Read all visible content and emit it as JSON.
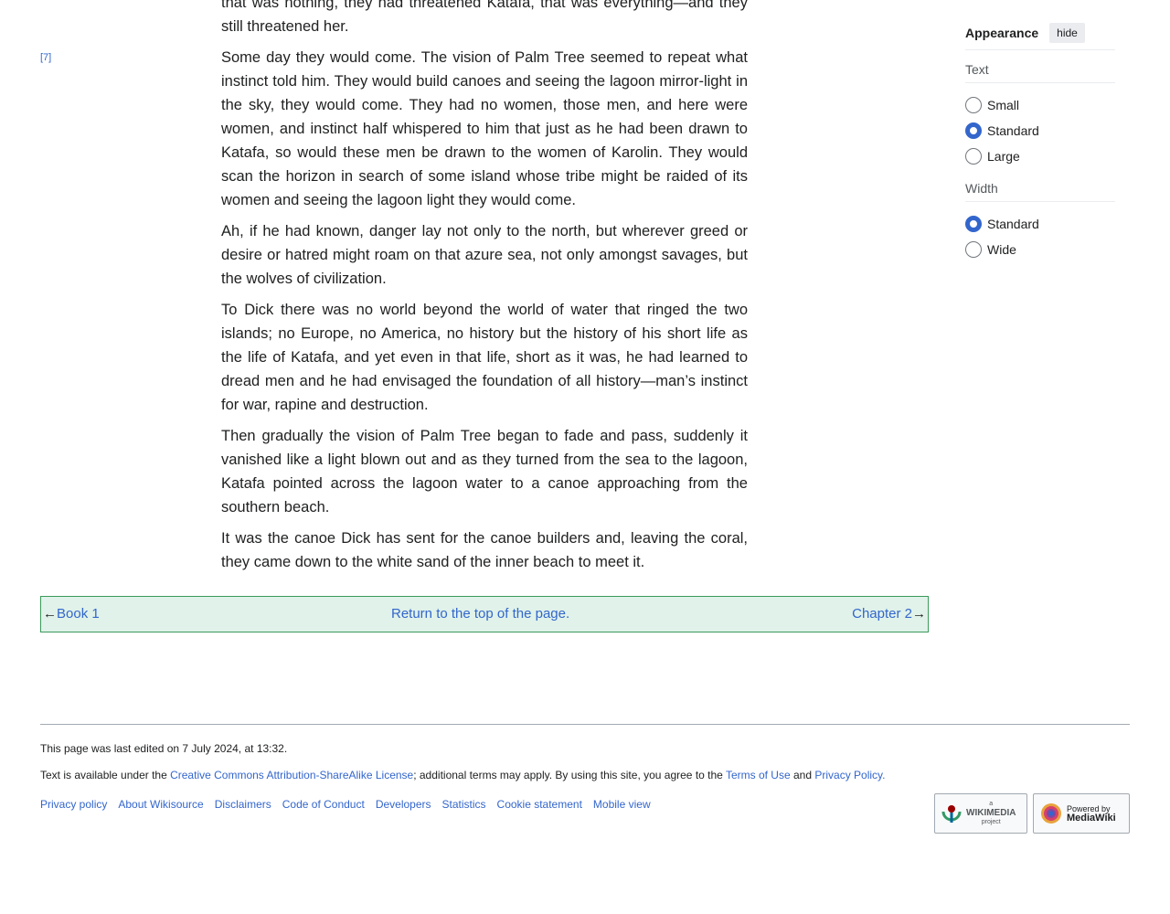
{
  "page_marker": "[7]",
  "paragraphs": [
    "that was nothing, they had threatened Katafa, that was everything—and they still threatened her.",
    "Some day they would come. The vision of Palm Tree seemed to repeat what instinct told him. They would build canoes and seeing the lagoon mirror-light in the sky, they would come. They had no women, those men, and here were women, and instinct half whispered to him that just as he had been drawn to Katafa, so would these men be drawn to the women of Karolin. They would scan the horizon in search of some island whose tribe might be raided of its women and seeing the lagoon light they would come.",
    "Ah, if he had known, danger lay not only to the north, but wherever greed or desire or hatred might roam on that azure sea, not only amongst savages, but the wolves of civilization.",
    "To Dick there was no world beyond the world of water that ringed the two islands; no Europe, no America, no history but the history of his short life as the life of Katafa, and yet even in that life, short as it was, he had learned to dread men and he had envisaged the foundation of all history—man’s instinct for war, rapine and destruction.",
    "Then gradually the vision of Palm Tree began to fade and pass, suddenly it vanished like a light blown out and as they turned from the sea to the lagoon, Katafa pointed across the lagoon water to a canoe approaching from the southern beach.",
    "It was the canoe Dick has sent for the canoe builders and, leaving the coral, they came down to the white sand of the inner beach to meet it."
  ],
  "nav": {
    "prev_arrow": "←",
    "prev_label": "Book 1",
    "top_label": "Return to the top of the page.",
    "next_label": "Chapter 2",
    "next_arrow": "→"
  },
  "appearance": {
    "title": "Appearance",
    "hide_label": "hide",
    "text_section": {
      "title": "Text",
      "options": [
        "Small",
        "Standard",
        "Large"
      ],
      "selected": "Standard"
    },
    "width_section": {
      "title": "Width",
      "options": [
        "Standard",
        "Wide"
      ],
      "selected": "Standard"
    }
  },
  "footer": {
    "last_edited": "This page was last edited on 7 July 2024, at 13:32.",
    "license_prefix": "Text is available under the ",
    "license_link": "Creative Commons Attribution-ShareAlike License",
    "license_middle": "; additional terms may apply. By using this site, you agree to the ",
    "terms_link": "Terms of Use",
    "and_text": " and ",
    "privacy_link": "Privacy Policy.",
    "links": [
      "Privacy policy",
      "About Wikisource",
      "Disclaimers",
      "Code of Conduct",
      "Developers",
      "Statistics",
      "Cookie statement",
      "Mobile view"
    ],
    "wikimedia_badge": [
      "a",
      "WIKIMEDIA",
      "project"
    ],
    "mediawiki_badge": [
      "Powered by",
      "MediaWiki"
    ]
  },
  "colors": {
    "link": "#3366cc",
    "nav_bg": "#e0f2e9",
    "nav_border": "#3a9a5b",
    "radio_checked": "#3366cc"
  }
}
